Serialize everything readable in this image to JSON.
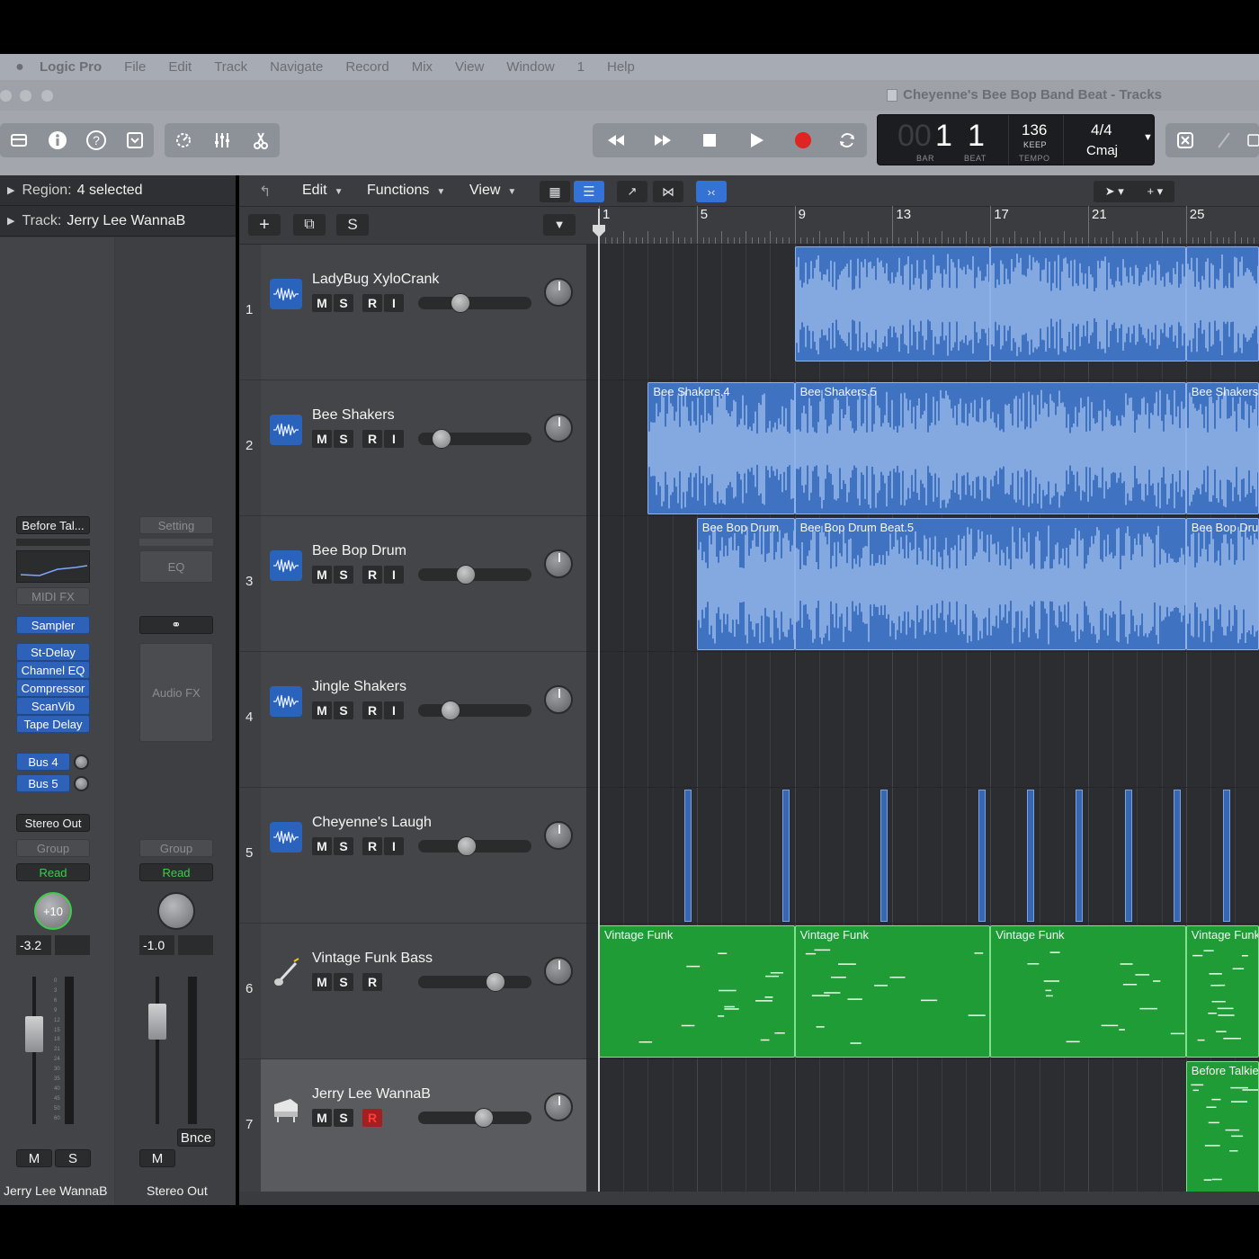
{
  "menu": {
    "app": "Logic Pro",
    "items": [
      "File",
      "Edit",
      "Track",
      "Navigate",
      "Record",
      "Mix",
      "View",
      "Window",
      "1",
      "Help"
    ]
  },
  "window": {
    "title": "Cheyenne's Bee Bop Band Beat - Tracks"
  },
  "lcd": {
    "bar": "1",
    "beat": "1",
    "bar_ghost": "00",
    "bar_label": "BAR",
    "beat_label": "BEAT",
    "tempo": "136",
    "keep": "KEEP",
    "tempo_label": "TEMPO",
    "sig": "4/4",
    "key": "Cmaj"
  },
  "inspector": {
    "region_label": "Region:",
    "region_value": "4 selected",
    "track_label": "Track:",
    "track_value": "Jerry Lee WannaB"
  },
  "strip1": {
    "setting": "Before Tal...",
    "midi_fx": "MIDI FX",
    "instrument": "Sampler",
    "fx": [
      "St-Delay",
      "Channel EQ",
      "Compressor",
      "ScanVib",
      "Tape Delay"
    ],
    "sends": [
      "Bus 4",
      "Bus 5"
    ],
    "output": "Stereo Out",
    "group": "Group",
    "automation": "Read",
    "pan_value": "+10",
    "volume": "-3.2",
    "mute": "M",
    "solo": "S",
    "name": "Jerry Lee WannaB"
  },
  "strip2": {
    "setting": "Setting",
    "eq": "EQ",
    "audio_fx": "Audio FX",
    "group": "Group",
    "automation": "Read",
    "volume": "-1.0",
    "mute": "M",
    "bounce": "Bnce",
    "name": "Stereo Out"
  },
  "meter_scale": [
    "0",
    "3",
    "6",
    "9",
    "12",
    "15",
    "18",
    "21",
    "24",
    "30",
    "35",
    "40",
    "45",
    "50",
    "60"
  ],
  "local_menu": {
    "edit": "Edit",
    "functions": "Functions",
    "view": "View"
  },
  "track_header_s": "S",
  "tracks": [
    {
      "num": "1",
      "name": "LadyBug XyloCrank",
      "fader": 0.35,
      "input": true
    },
    {
      "num": "2",
      "name": "Bee Shakers",
      "fader": 0.14,
      "input": true
    },
    {
      "num": "3",
      "name": "Bee Bop Drum",
      "fader": 0.4,
      "input": true
    },
    {
      "num": "4",
      "name": "Jingle Shakers",
      "fader": 0.24,
      "input": true
    },
    {
      "num": "5",
      "name": "Cheyenne's Laugh",
      "fader": 0.41,
      "input": true
    },
    {
      "num": "6",
      "name": "Vintage Funk Bass",
      "fader": 0.72,
      "input": false
    },
    {
      "num": "7",
      "name": "Jerry Lee WannaB",
      "fader": 0.6,
      "input": false
    }
  ],
  "track_buttons": {
    "mute": "M",
    "solo": "S",
    "rec": "R",
    "input": "I"
  },
  "ruler": [
    "1",
    "5",
    "9",
    "13",
    "17",
    "21",
    "25"
  ],
  "regions": {
    "shakers": [
      "Bee Shakers.4",
      "Bee Shakers.5",
      "Bee Shakers."
    ],
    "drums": [
      "Bee Bop Drum",
      "Bee Bop Drum Beat.5",
      "Bee Bop Drur"
    ],
    "funk": [
      "Vintage Funk",
      "Vintage Funk",
      "Vintage Funk",
      "Vintage Funk"
    ],
    "talkie": "Before Talkie"
  },
  "colors": {
    "audio": "#3f73c2",
    "midi": "#1f9c36",
    "rec": "#e02323"
  }
}
